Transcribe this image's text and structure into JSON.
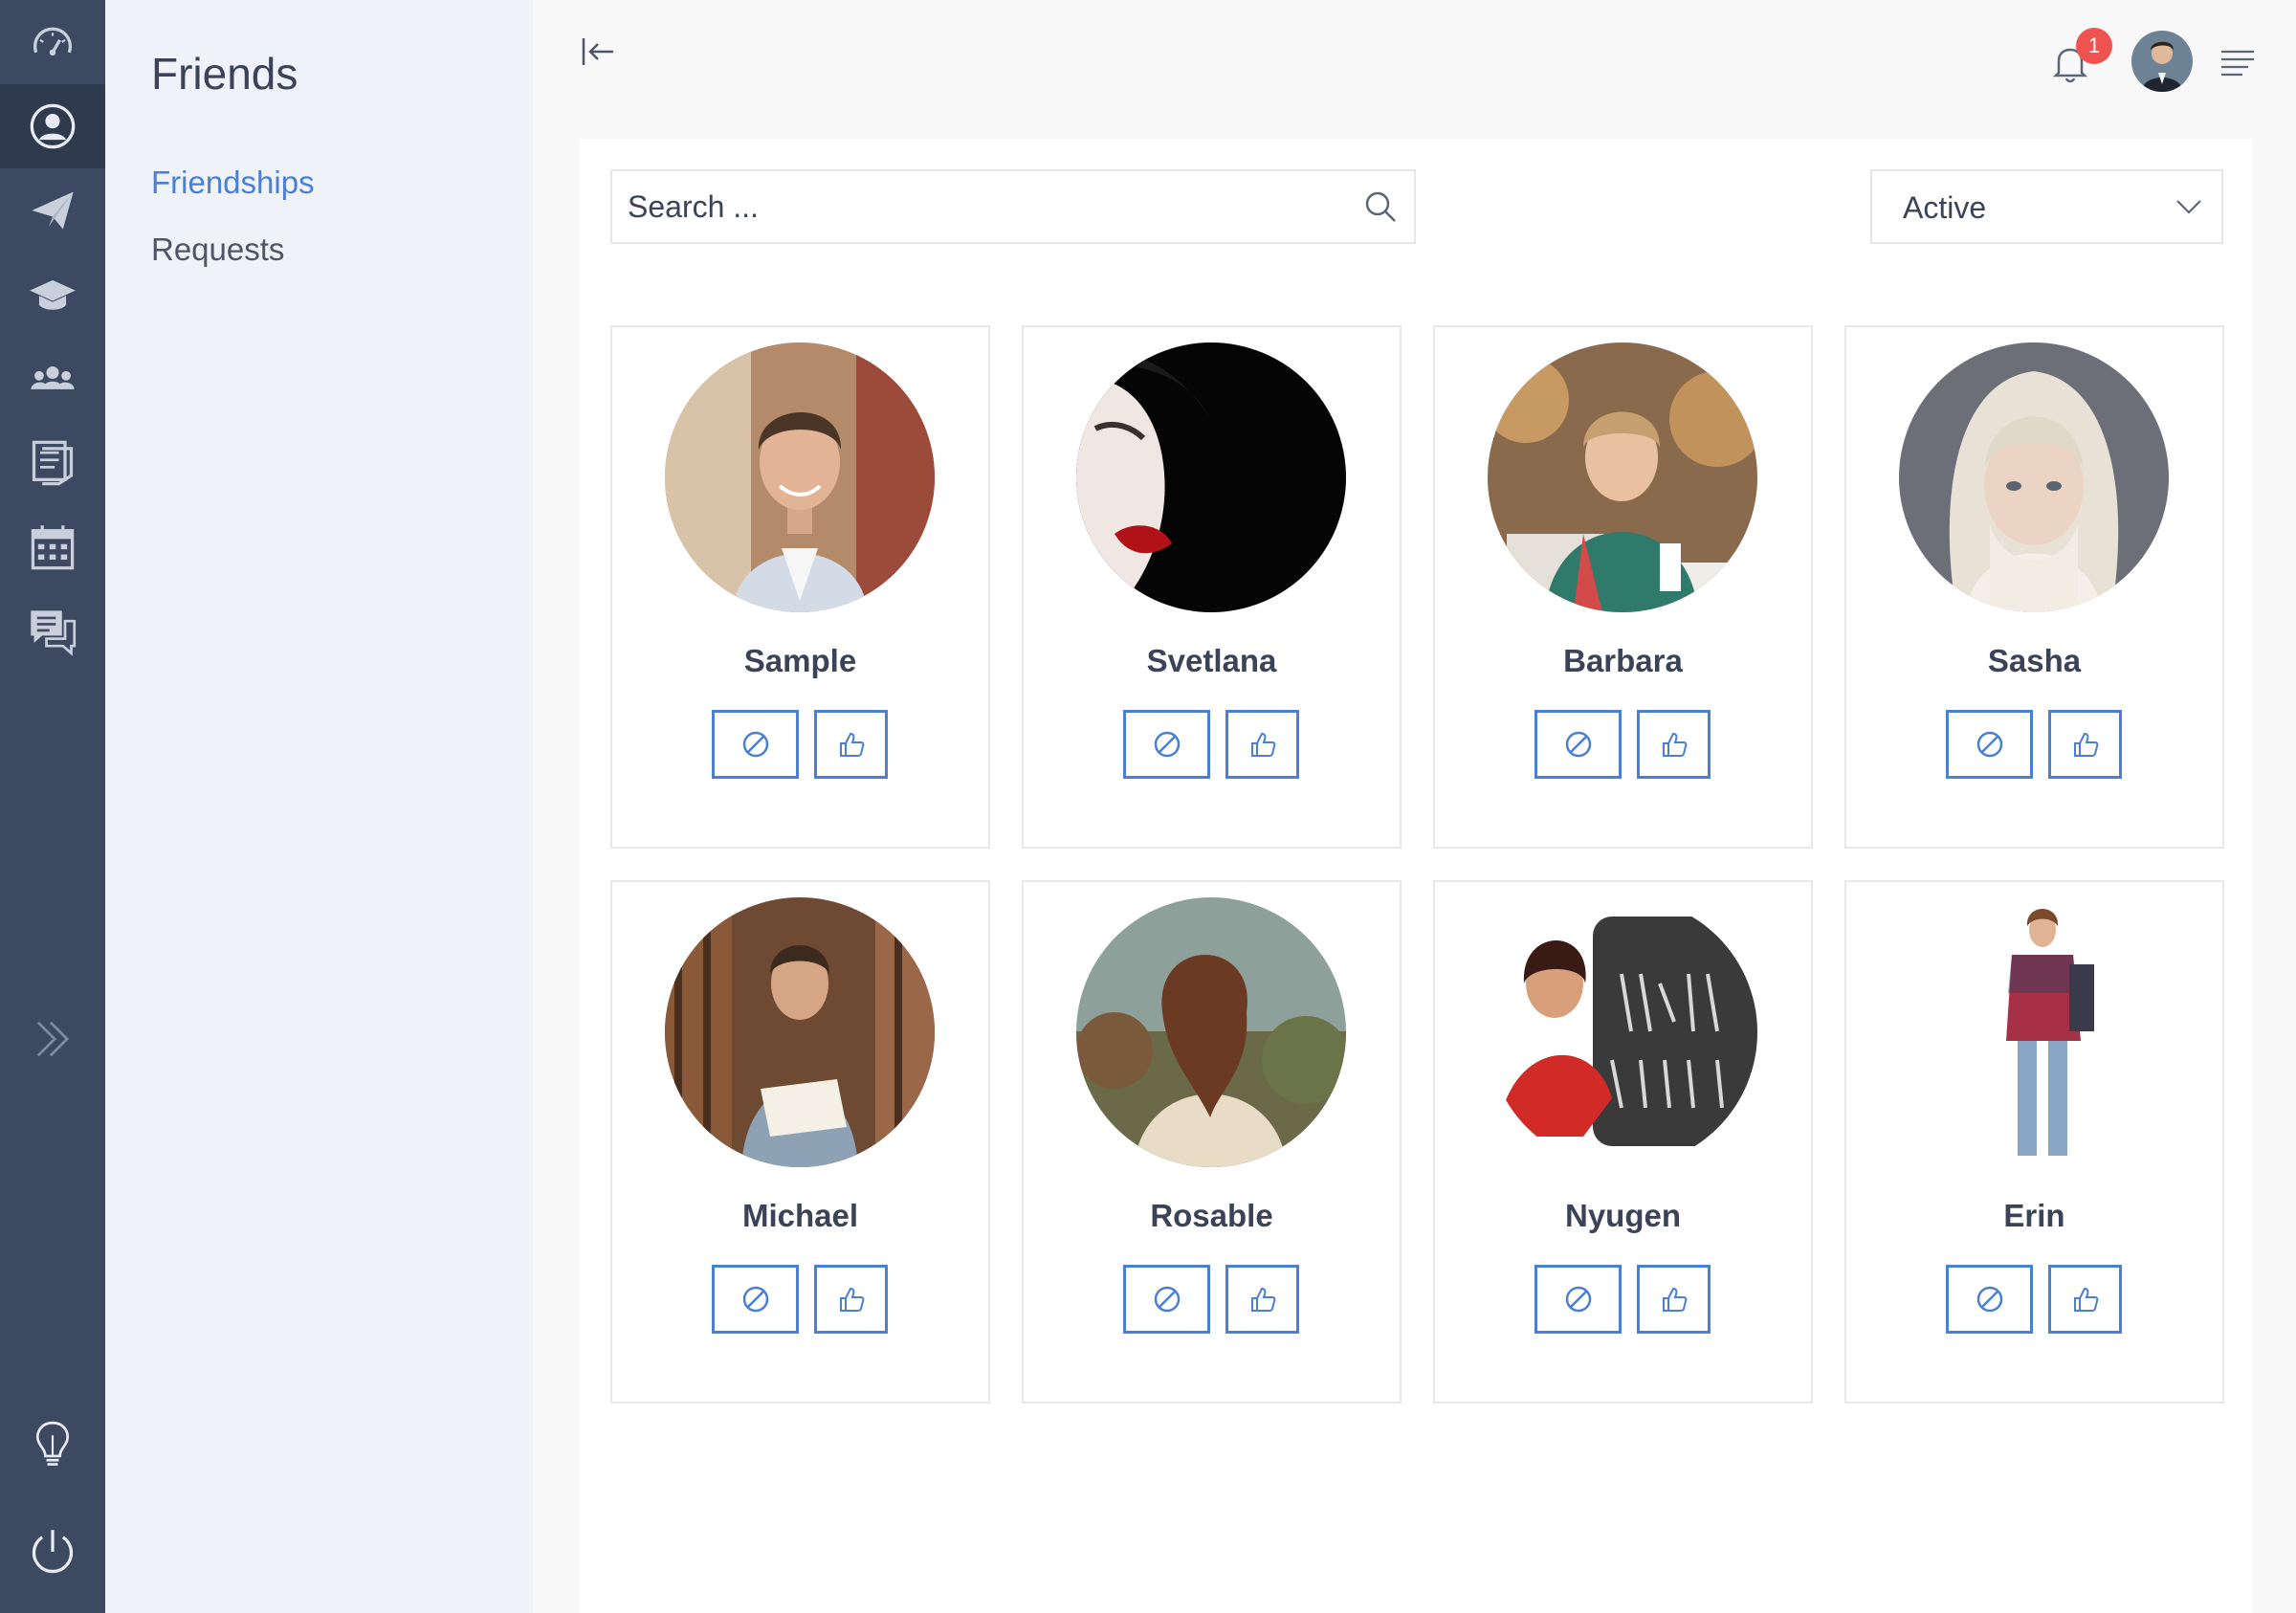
{
  "rail": {
    "items": [
      {
        "icon": "dashboard-icon",
        "active": false
      },
      {
        "icon": "user-circle-icon",
        "active": true
      },
      {
        "icon": "paper-plane-icon",
        "active": false
      },
      {
        "icon": "graduation-cap-icon",
        "active": false
      },
      {
        "icon": "group-icon",
        "active": false
      },
      {
        "icon": "notes-icon",
        "active": false
      },
      {
        "icon": "calendar-icon",
        "active": false
      },
      {
        "icon": "chat-icon",
        "active": false
      }
    ],
    "expand_icon": "double-chevron-right-icon",
    "bottom": [
      "lightbulb-icon",
      "power-icon"
    ]
  },
  "subnav": {
    "title": "Friends",
    "links": [
      {
        "label": "Friendships",
        "active": true
      },
      {
        "label": "Requests",
        "active": false
      }
    ]
  },
  "topbar": {
    "notification_count": "1"
  },
  "toolbar": {
    "search_placeholder": "Search ...",
    "filter_value": "Active"
  },
  "friends": [
    {
      "name": "Sample"
    },
    {
      "name": "Svetlana"
    },
    {
      "name": "Barbara"
    },
    {
      "name": "Sasha"
    },
    {
      "name": "Michael"
    },
    {
      "name": "Rosable"
    },
    {
      "name": "Nyugen"
    },
    {
      "name": "Erin"
    }
  ],
  "colors": {
    "accent": "#4a7fd4",
    "rail": "#3c4961",
    "rail_active": "#2f3a4f",
    "badge": "#ef5350"
  }
}
